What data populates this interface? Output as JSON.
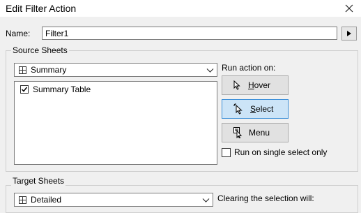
{
  "window": {
    "title": "Edit Filter Action",
    "close_icon": "close-icon"
  },
  "name_row": {
    "label": "Name:",
    "value": "Filter1"
  },
  "source_sheets": {
    "title": "Source Sheets",
    "dropdown_value": "Summary",
    "items": [
      {
        "label": "Summary Table",
        "checked": true
      }
    ]
  },
  "run_action": {
    "label": "Run action on:",
    "buttons": [
      {
        "label": "Hover",
        "icon": "pointer-icon",
        "active": false
      },
      {
        "label": "Select",
        "icon": "click-pointer-icon",
        "active": true
      },
      {
        "label": "Menu",
        "icon": "menu-pointer-icon",
        "active": false
      }
    ],
    "single_select_label": "Run on single select only",
    "single_select_checked": false
  },
  "target_sheets": {
    "title": "Target Sheets",
    "dropdown_value": "Detailed",
    "clearing_label": "Clearing the selection will:"
  },
  "colors": {
    "active_button_bg": "#cce4f7",
    "active_button_border": "#3c8fd8"
  }
}
